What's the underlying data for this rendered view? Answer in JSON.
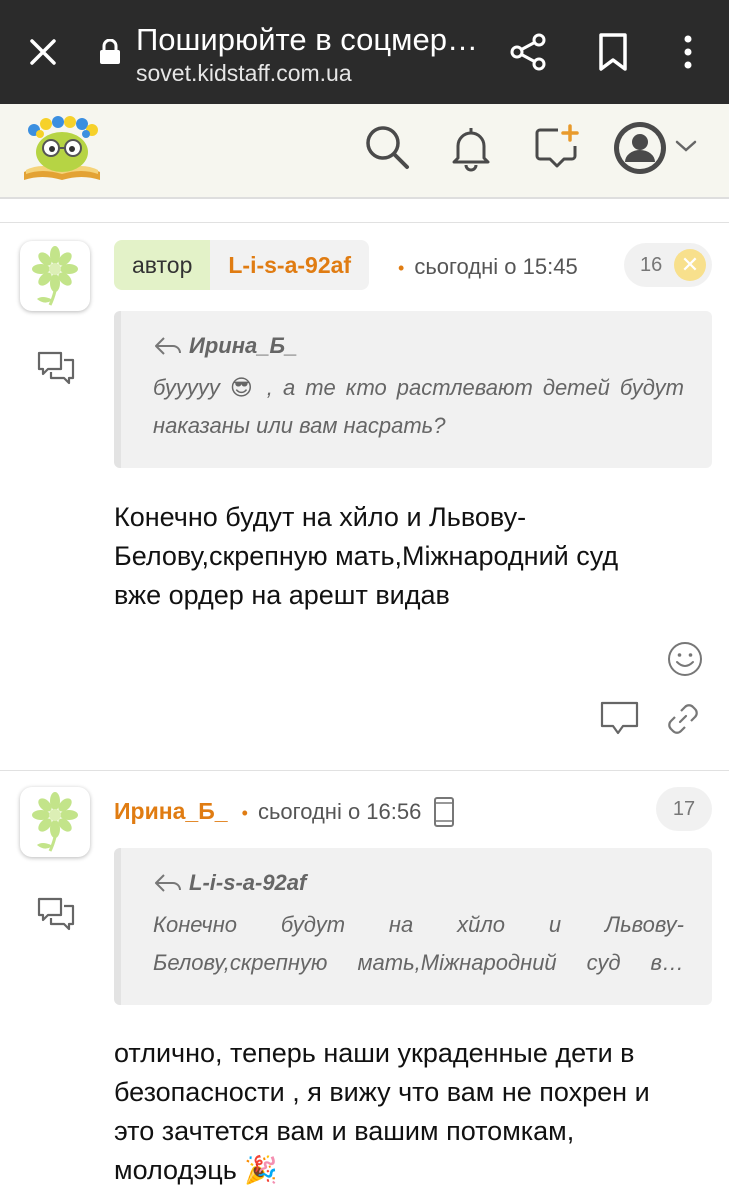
{
  "browser": {
    "tab_title": "Поширюйте в соцмер…",
    "url": "sovet.kidstaff.com.ua"
  },
  "posts": [
    {
      "role_label": "автор",
      "author": "L-i-s-a-92af",
      "time": "сьогодні о 15:45",
      "number": "16",
      "quote": {
        "author": "Ирина_Б_",
        "text_line1": "бууууу 😎 , а те кто растлевают детей будут",
        "text_line2": "наказаны или вам насрать?"
      },
      "body_lines": [
        "Конечно будут на хйло и Львову-",
        "Белову,скрепную мать,Міжнародний суд",
        "вже ордер на арешт видав"
      ]
    },
    {
      "author": "Ирина_Б_",
      "time": "сьогодні о 16:56",
      "number": "17",
      "quote": {
        "author": "L-i-s-a-92af",
        "text_line1": "Конечно будут на хйло и Львову-",
        "text_line2": "Белову,скрепную мать,Міжнародний суд в…"
      },
      "body_lines": [
        "отлично, теперь наши украденные дети в",
        "безопасности , я вижу что вам не похрен и",
        "это зачтется вам и вашим потомкам,",
        "молодэць 🎉"
      ]
    }
  ],
  "colors": {
    "nick": "#e07c12",
    "author_badge": "#e3f2c8",
    "chrome": "#2b2b2b",
    "header_bg": "#f6f6ef"
  }
}
